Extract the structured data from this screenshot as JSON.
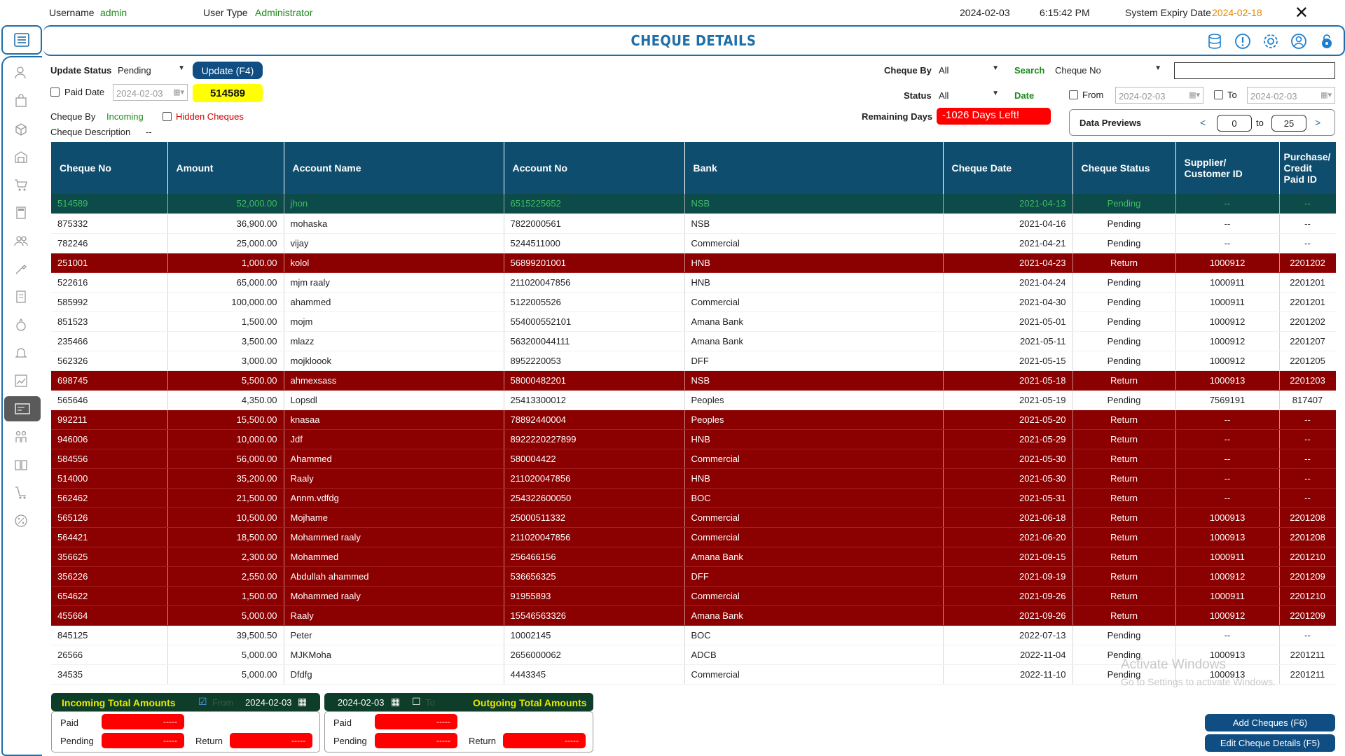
{
  "topbar": {
    "username_label": "Username",
    "username": "admin",
    "usertype_label": "User Type",
    "usertype": "Administrator",
    "date": "2024-02-03",
    "time": "6:15:42 PM",
    "expiry_label": "System Expiry Date",
    "expiry": "2024-02-18",
    "close": "✕"
  },
  "header": {
    "title": "CHEQUE DETAILS"
  },
  "controls": {
    "update_status_label": "Update Status",
    "update_status_value": "Pending",
    "update_button": "Update (F4)",
    "paid_date_label": "Paid Date",
    "paid_date_value": "2024-02-03",
    "selected_cheque": "514589",
    "cheque_by_label": "Cheque By",
    "cheque_by_value": "Incoming",
    "hidden_cheques_label": "Hidden Cheques",
    "cheque_desc_label": "Cheque Description",
    "cheque_desc_value": "--",
    "filter_cheque_by_label": "Cheque By",
    "filter_cheque_by_value": "All",
    "search_label": "Search",
    "search_field_value": "Cheque No",
    "search_input": "",
    "status_label": "Status",
    "status_value": "All",
    "date_label": "Date",
    "from_label": "From",
    "from_value": "2024-02-03",
    "to_label": "To",
    "to_value": "2024-02-03",
    "remaining_label": "Remaining Days",
    "remaining_value": "-1026 Days Left!",
    "preview_label": "Data Previews",
    "prev": "<",
    "next": ">",
    "preview_from": "0",
    "preview_to_label": "to",
    "preview_to": "25"
  },
  "table": {
    "headers": [
      "Cheque No",
      "Amount",
      "Account Name",
      "Account No",
      "Bank",
      "Cheque Date",
      "Cheque Status",
      "Supplier/ Customer ID",
      "Purchase/ Credit Paid ID"
    ],
    "rows": [
      {
        "no": "514589",
        "amount": "52,000.00",
        "name": "jhon",
        "acc": "6515225652",
        "bank": "NSB",
        "date": "2021-04-13",
        "status": "Pending",
        "sup": "--",
        "pur": "--",
        "type": "selected"
      },
      {
        "no": "875332",
        "amount": "36,900.00",
        "name": "mohaska",
        "acc": "7822000561",
        "bank": "NSB",
        "date": "2021-04-16",
        "status": "Pending",
        "sup": "--",
        "pur": "--",
        "type": "normal"
      },
      {
        "no": "782246",
        "amount": "25,000.00",
        "name": "vijay",
        "acc": "5244511000",
        "bank": "Commercial",
        "date": "2021-04-21",
        "status": "Pending",
        "sup": "--",
        "pur": "--",
        "type": "normal"
      },
      {
        "no": "251001",
        "amount": "1,000.00",
        "name": "kolol",
        "acc": "56899201001",
        "bank": "HNB",
        "date": "2021-04-23",
        "status": "Return",
        "sup": "1000912",
        "pur": "2201202",
        "type": "return"
      },
      {
        "no": "522616",
        "amount": "65,000.00",
        "name": "mjm raaly",
        "acc": "211020047856",
        "bank": "HNB",
        "date": "2021-04-24",
        "status": "Pending",
        "sup": "1000911",
        "pur": "2201201",
        "type": "normal"
      },
      {
        "no": "585992",
        "amount": "100,000.00",
        "name": "ahammed",
        "acc": "5122005526",
        "bank": "Commercial",
        "date": "2021-04-30",
        "status": "Pending",
        "sup": "1000911",
        "pur": "2201201",
        "type": "normal"
      },
      {
        "no": "851523",
        "amount": "1,500.00",
        "name": "mojm",
        "acc": "554000552101",
        "bank": "Amana Bank",
        "date": "2021-05-01",
        "status": "Pending",
        "sup": "1000912",
        "pur": "2201202",
        "type": "normal"
      },
      {
        "no": "235466",
        "amount": "3,500.00",
        "name": "mlazz",
        "acc": "563200044111",
        "bank": "Amana Bank",
        "date": "2021-05-11",
        "status": "Pending",
        "sup": "1000912",
        "pur": "2201207",
        "type": "normal"
      },
      {
        "no": "562326",
        "amount": "3,000.00",
        "name": "mojkloook",
        "acc": "8952220053",
        "bank": "DFF",
        "date": "2021-05-15",
        "status": "Pending",
        "sup": "1000912",
        "pur": "2201205",
        "type": "normal"
      },
      {
        "no": "698745",
        "amount": "5,500.00",
        "name": "ahmexsass",
        "acc": "58000482201",
        "bank": "NSB",
        "date": "2021-05-18",
        "status": "Return",
        "sup": "1000913",
        "pur": "2201203",
        "type": "return"
      },
      {
        "no": "565646",
        "amount": "4,350.00",
        "name": "Lopsdl",
        "acc": "25413300012",
        "bank": "Peoples",
        "date": "2021-05-19",
        "status": "Pending",
        "sup": "7569191",
        "pur": "817407",
        "type": "normal"
      },
      {
        "no": "992211",
        "amount": "15,500.00",
        "name": "knasaa",
        "acc": "78892440004",
        "bank": "Peoples",
        "date": "2021-05-20",
        "status": "Return",
        "sup": "--",
        "pur": "--",
        "type": "return"
      },
      {
        "no": "946006",
        "amount": "10,000.00",
        "name": "Jdf",
        "acc": "8922220227899",
        "bank": "HNB",
        "date": "2021-05-29",
        "status": "Return",
        "sup": "--",
        "pur": "--",
        "type": "return"
      },
      {
        "no": "584556",
        "amount": "56,000.00",
        "name": "Ahammed",
        "acc": "580004422",
        "bank": "Commercial",
        "date": "2021-05-30",
        "status": "Return",
        "sup": "--",
        "pur": "--",
        "type": "return"
      },
      {
        "no": "514000",
        "amount": "35,200.00",
        "name": "Raaly",
        "acc": "211020047856",
        "bank": "HNB",
        "date": "2021-05-30",
        "status": "Return",
        "sup": "--",
        "pur": "--",
        "type": "return"
      },
      {
        "no": "562462",
        "amount": "21,500.00",
        "name": "Annm.vdfdg",
        "acc": "254322600050",
        "bank": "BOC",
        "date": "2021-05-31",
        "status": "Return",
        "sup": "--",
        "pur": "--",
        "type": "return"
      },
      {
        "no": "565126",
        "amount": "10,500.00",
        "name": "Mojhame",
        "acc": "25000511332",
        "bank": "Commercial",
        "date": "2021-06-18",
        "status": "Return",
        "sup": "1000913",
        "pur": "2201208",
        "type": "return"
      },
      {
        "no": "564421",
        "amount": "18,500.00",
        "name": "Mohammed raaly",
        "acc": "211020047856",
        "bank": "Commercial",
        "date": "2021-06-20",
        "status": "Return",
        "sup": "1000913",
        "pur": "2201208",
        "type": "return"
      },
      {
        "no": "356625",
        "amount": "2,300.00",
        "name": "Mohammed",
        "acc": "256466156",
        "bank": "Amana Bank",
        "date": "2021-09-15",
        "status": "Return",
        "sup": "1000911",
        "pur": "2201210",
        "type": "return"
      },
      {
        "no": "356226",
        "amount": "2,550.00",
        "name": "Abdullah ahammed",
        "acc": "536656325",
        "bank": "DFF",
        "date": "2021-09-19",
        "status": "Return",
        "sup": "1000912",
        "pur": "2201209",
        "type": "return"
      },
      {
        "no": "654622",
        "amount": "1,500.00",
        "name": "Mohammed raaly",
        "acc": "91955893",
        "bank": "Commercial",
        "date": "2021-09-26",
        "status": "Return",
        "sup": "1000911",
        "pur": "2201210",
        "type": "return"
      },
      {
        "no": "455664",
        "amount": "5,000.00",
        "name": "Raaly",
        "acc": "15546563326",
        "bank": "Amana Bank",
        "date": "2021-09-26",
        "status": "Return",
        "sup": "1000912",
        "pur": "2201209",
        "type": "return"
      },
      {
        "no": "845125",
        "amount": "39,500.50",
        "name": "Peter",
        "acc": "10002145",
        "bank": "BOC",
        "date": "2022-07-13",
        "status": "Pending",
        "sup": "--",
        "pur": "--",
        "type": "normal"
      },
      {
        "no": "26566",
        "amount": "5,000.00",
        "name": "MJKMoha",
        "acc": "2656000062",
        "bank": "ADCB",
        "date": "2022-11-04",
        "status": "Pending",
        "sup": "1000913",
        "pur": "2201211",
        "type": "normal"
      },
      {
        "no": "34535",
        "amount": "5,000.00",
        "name": "Dfdfg",
        "acc": "4443345",
        "bank": "Commercial",
        "date": "2022-11-10",
        "status": "Pending",
        "sup": "1000913",
        "pur": "2201211",
        "type": "normal"
      }
    ]
  },
  "incoming": {
    "title": "Incoming Total Amounts",
    "from_label": "From",
    "from_date": "2024-02-03",
    "paid_label": "Paid",
    "pending_label": "Pending",
    "return_label": "Return",
    "paid": "-----",
    "pending": "-----",
    "return": "-----"
  },
  "outgoing": {
    "title": "Outgoing Total Amounts",
    "to_label": "To",
    "to_date": "2024-02-03",
    "paid_label": "Paid",
    "pending_label": "Pending",
    "return_label": "Return",
    "paid": "-----",
    "pending": "-----",
    "return": "-----"
  },
  "actions": {
    "add": "Add Cheques (F6)",
    "edit": "Edit Cheque Details (F5)"
  },
  "watermark": {
    "line1": "Activate Windows",
    "line2": "Go to Settings to activate Windows."
  },
  "colors": {
    "accent": "#1e6ea7",
    "header_bg": "#0e4d6e",
    "return_row": "#8b0000",
    "selected_row": "#0d4a4a",
    "alert": "#ff0000",
    "highlight": "#ffff00"
  }
}
